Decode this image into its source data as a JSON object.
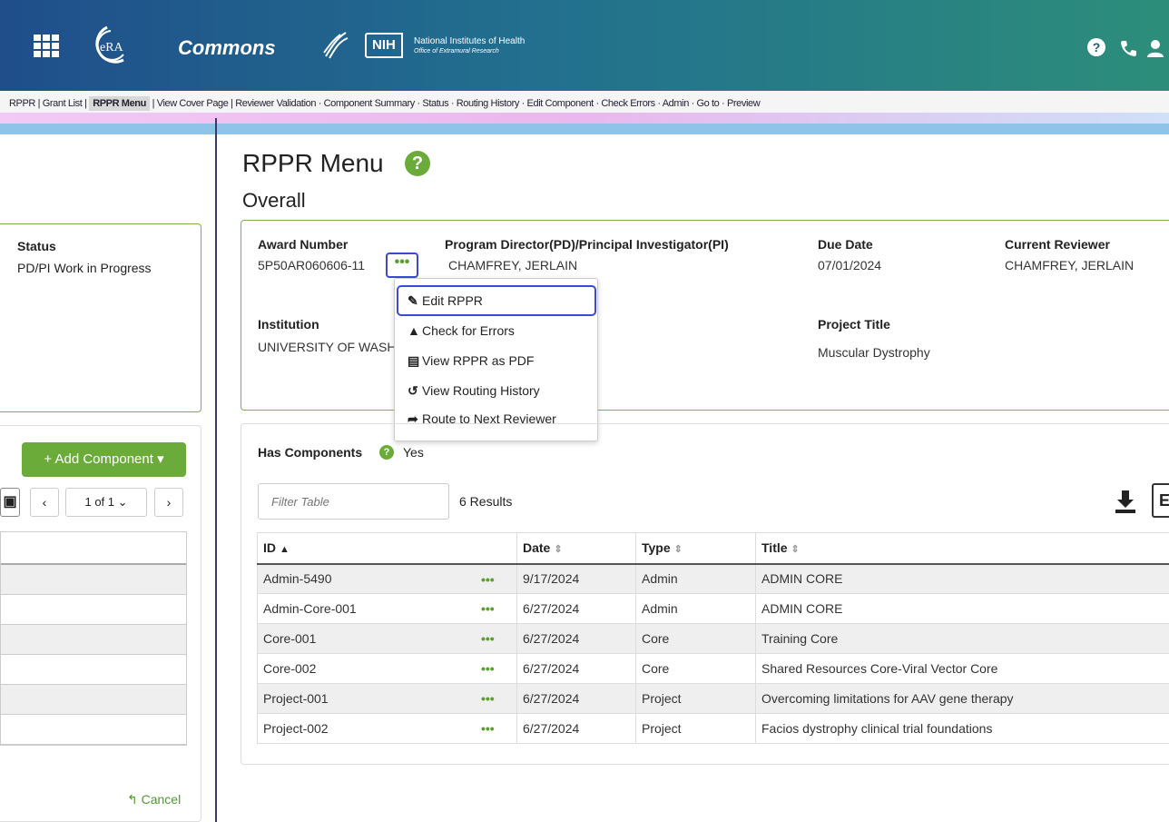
{
  "header": {
    "logo_text": "eRA",
    "commons_label": "Commons",
    "nih_badge": "NIH",
    "nih_title": "National Institutes of Health",
    "nih_subtitle": "Office of Extramural Research",
    "help_icon": "question-circle-icon",
    "phone_icon": "phone-icon",
    "user_icon": "user-icon"
  },
  "breadcrumb": {
    "pre": "RPPR | Grant List | ",
    "current": "RPPR Menu",
    "post": " | View Cover Page | Reviewer Validation · Component Summary · Status · Routing History · Edit Component · Check Errors · Admin · Go to · Preview"
  },
  "left_panel": {
    "status_label": "Status",
    "status_value": "PD/PI Work in Progress",
    "add_component_label": "+ Add Component ▾",
    "pager_prev": "‹",
    "pager_select": "1 of 1 ⌄",
    "pager_next": "›",
    "cancel_label": "↰ Cancel"
  },
  "page": {
    "title": "RPPR Menu",
    "subtitle": "Overall"
  },
  "overall": {
    "award_number_label": "Award Number",
    "award_number": "5P50AR060606-11",
    "pdpi_label": "Program Director(PD)/Principal Investigator(PI)",
    "pdpi_value": "CHAMFREY, JERLAIN",
    "due_date_label": "Due Date",
    "due_date": "07/01/2024",
    "current_reviewer_label": "Current Reviewer",
    "current_reviewer": "CHAMFREY, JERLAIN",
    "institution_label": "Institution",
    "institution": "UNIVERSITY OF WASH",
    "project_title_label": "Project Title",
    "project_title": "Muscular Dystrophy",
    "actions_label": "•••"
  },
  "actions_menu": {
    "items": [
      {
        "label": "Edit RPPR",
        "icon": "edit-icon"
      },
      {
        "label": "Check for Errors",
        "icon": "warning-icon"
      },
      {
        "label": "View RPPR as PDF",
        "icon": "pdf-icon"
      },
      {
        "label": "View Routing History",
        "icon": "history-icon"
      },
      {
        "label": "Route to Next Reviewer",
        "icon": "share-icon"
      }
    ]
  },
  "components": {
    "has_components_label": "Has Components",
    "has_components_value": "Yes",
    "filter_placeholder": "Filter Table",
    "results_text": "6 Results",
    "columns": [
      "ID",
      "Date",
      "Type",
      "Title"
    ],
    "rows": [
      {
        "id": "Admin-5490",
        "date": "9/17/2024",
        "type": "Admin",
        "title": "ADMIN CORE"
      },
      {
        "id": "Admin-Core-001",
        "date": "6/27/2024",
        "type": "Admin",
        "title": "ADMIN CORE"
      },
      {
        "id": "Core-001",
        "date": "6/27/2024",
        "type": "Core",
        "title": "Training Core"
      },
      {
        "id": "Core-002",
        "date": "6/27/2024",
        "type": "Core",
        "title": "Shared Resources Core-Viral Vector Core"
      },
      {
        "id": "Project-001",
        "date": "6/27/2024",
        "type": "Project",
        "title": "Overcoming limitations for AAV gene therapy"
      },
      {
        "id": "Project-002",
        "date": "6/27/2024",
        "type": "Project",
        "title": "Facios dystrophy clinical trial foundations"
      }
    ],
    "row_actions": "•••"
  },
  "colors": {
    "accent_green": "#6aab3a",
    "focus_blue": "#3a4bd1",
    "header_start": "#1f4e8a",
    "header_end": "#2c8e7a"
  }
}
